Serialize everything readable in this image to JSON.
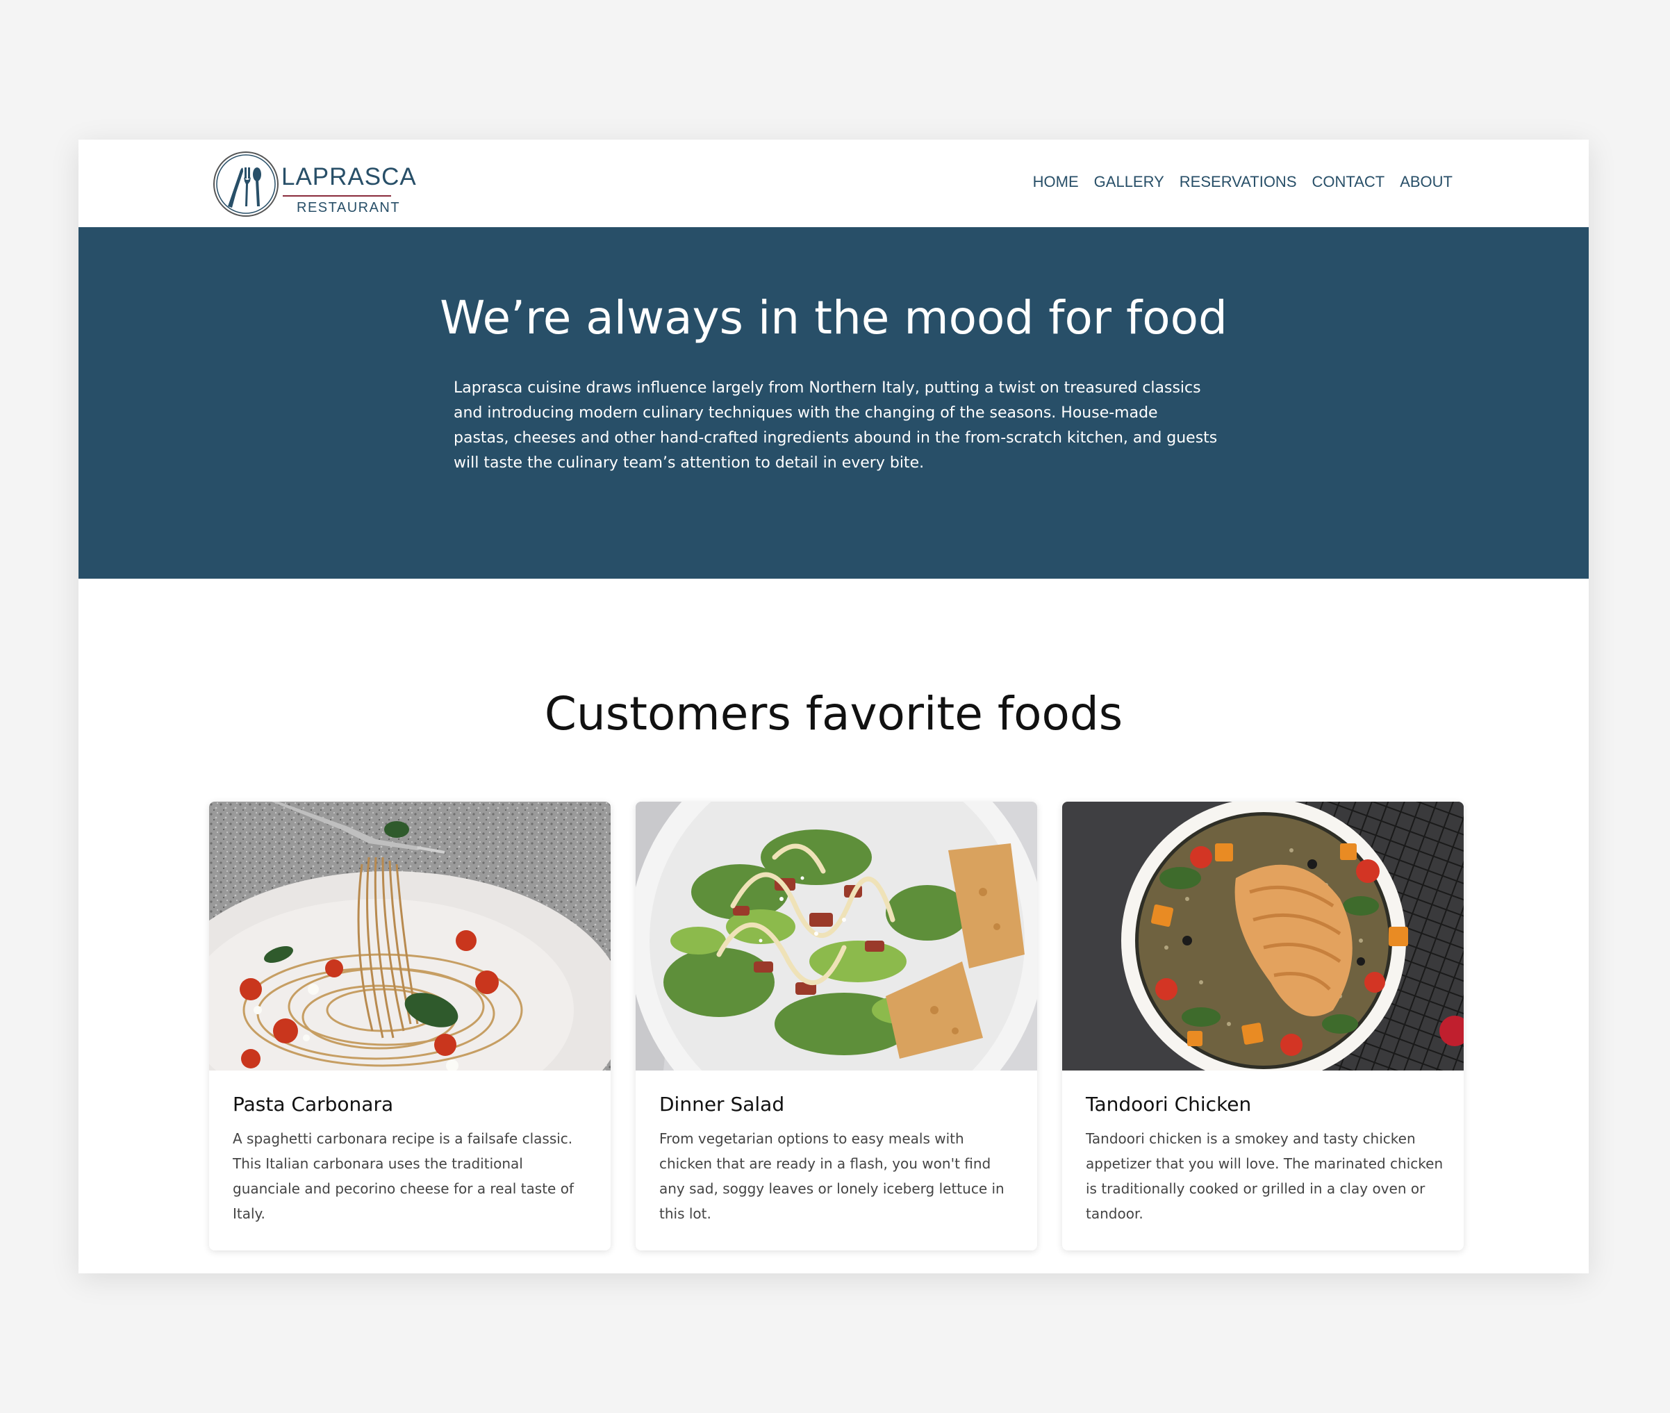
{
  "brand": {
    "name": "LAPRASCA",
    "subtitle": "RESTAURANT",
    "accent": "#284f68",
    "underline_color": "#8a2c3c"
  },
  "nav": {
    "items": [
      {
        "label": "HOME"
      },
      {
        "label": "GALLERY"
      },
      {
        "label": "RESERVATIONS"
      },
      {
        "label": "CONTACT"
      },
      {
        "label": "ABOUT"
      }
    ]
  },
  "hero": {
    "title": "We’re always in the mood for food",
    "description": "Laprasca cuisine draws influence largely from Northern Italy, putting a twist on treasured classics and introducing modern culinary techniques with the changing of the seasons. House-made pastas, cheeses and other hand-crafted ingredients abound in the from-scratch kitchen, and guests will taste the culinary team’s attention to detail in every bite.",
    "background": "#284f68"
  },
  "favorites": {
    "title": "Customers favorite foods",
    "cards": [
      {
        "title": "Pasta Carbonara",
        "text": "A spaghetti carbonara recipe is a failsafe classic. This Italian carbonara uses the traditional guanciale and pecorino cheese for a real taste of Italy.",
        "image": "pasta-photo"
      },
      {
        "title": "Dinner Salad",
        "text": "From vegetarian options to easy meals with chicken that are ready in a flash, you won't find any sad, soggy leaves or lonely iceberg lettuce in this lot.",
        "image": "salad-photo"
      },
      {
        "title": "Tandoori Chicken",
        "text": "Tandoori chicken is a smokey and tasty chicken appetizer that you will love. The marinated chicken is traditionally cooked or grilled in a clay oven or tandoor.",
        "image": "chicken-bowl-photo"
      }
    ]
  }
}
